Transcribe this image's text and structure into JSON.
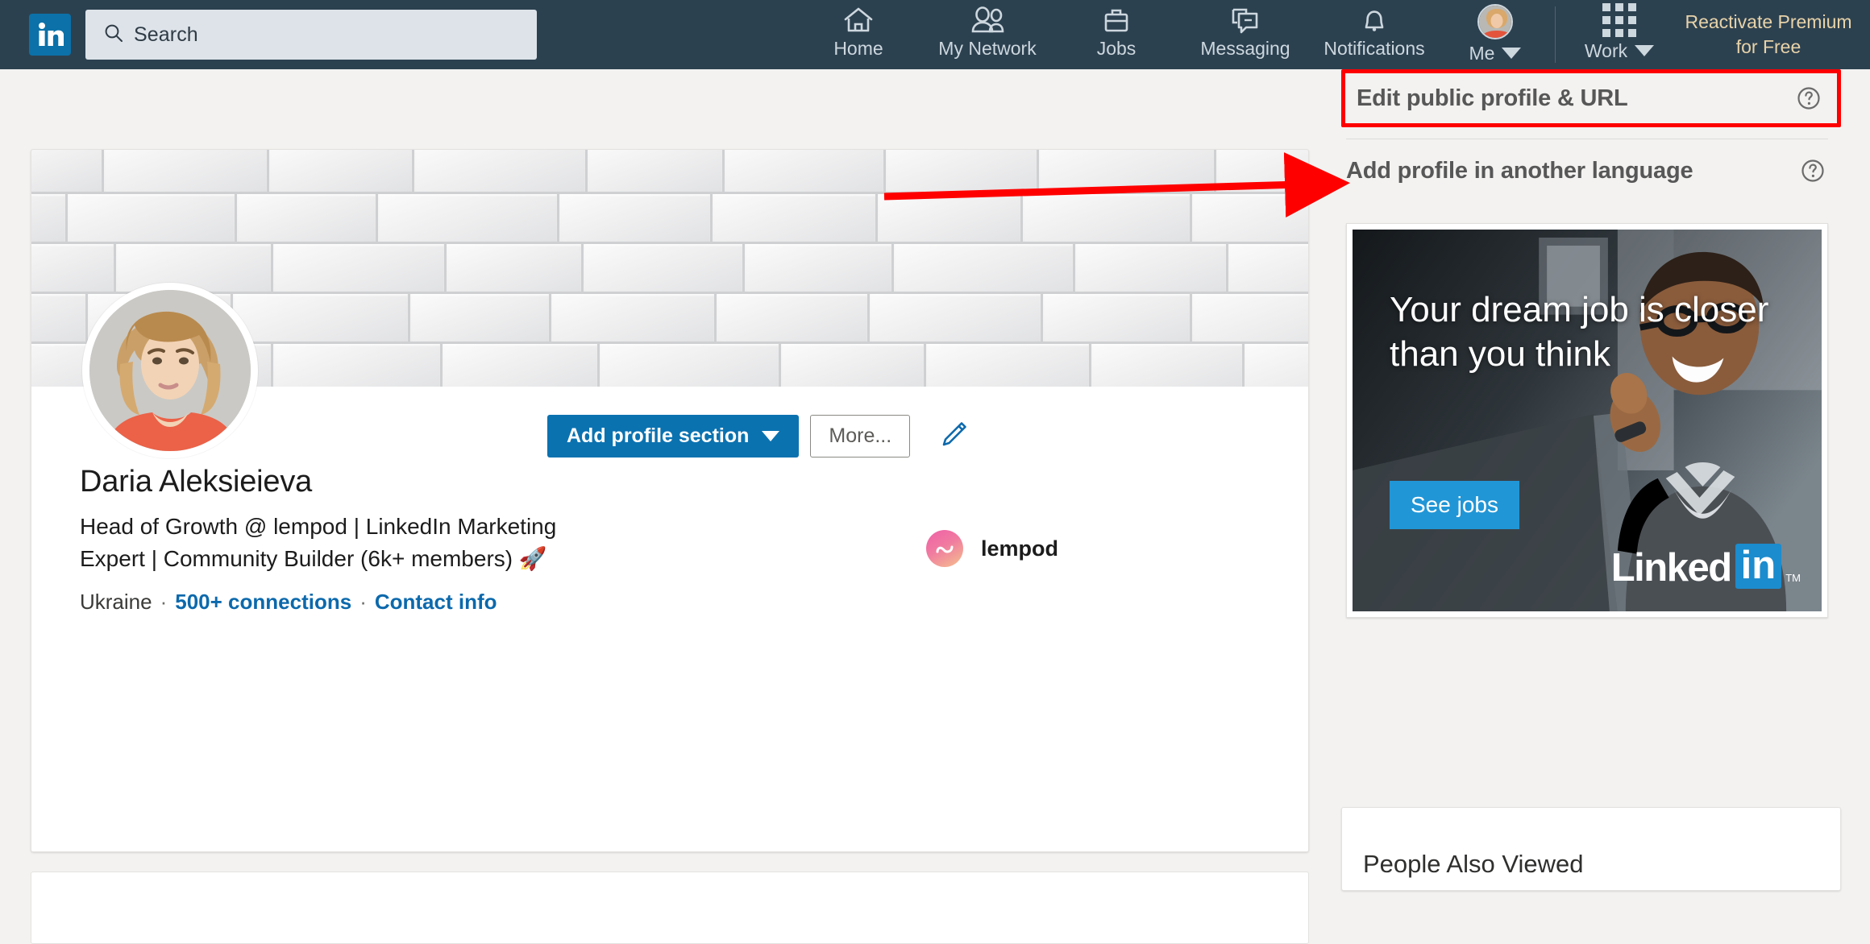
{
  "nav": {
    "logo_alt": "LinkedIn",
    "search_placeholder": "Search",
    "items": [
      {
        "label": "Home",
        "icon": "home-icon"
      },
      {
        "label": "My Network",
        "icon": "people-icon"
      },
      {
        "label": "Jobs",
        "icon": "briefcase-icon"
      },
      {
        "label": "Messaging",
        "icon": "message-icon"
      },
      {
        "label": "Notifications",
        "icon": "bell-icon"
      }
    ],
    "me_label": "Me",
    "work_label": "Work",
    "premium_label": "Reactivate Premium for Free"
  },
  "profile": {
    "name": "Daria Aleksieieva",
    "headline": "Head of Growth @ lempod | LinkedIn Marketing Expert | Community Builder (6k+ members) 🚀",
    "location": "Ukraine",
    "separator": "·",
    "connections": "500+ connections",
    "contact_info": "Contact info",
    "company_name": "lempod",
    "buttons": {
      "add_section": "Add profile section",
      "more": "More..."
    },
    "edit_icon": "pencil-icon"
  },
  "sidebar": {
    "links": [
      {
        "label": "Edit public profile & URL",
        "help_icon": "question-circle-icon",
        "highlighted": true
      },
      {
        "label": "Add profile in another language",
        "help_icon": "question-circle-icon",
        "highlighted": false
      }
    ],
    "ad": {
      "headline": "Your dream job is closer than you think",
      "cta": "See jobs",
      "brand_word": "Linked",
      "brand_box": "in",
      "trademark": "TM"
    },
    "people_also_viewed": "People Also Viewed"
  },
  "colors": {
    "nav_background": "#2c4150",
    "brand_blue": "#0b72b0",
    "link_blue": "#0c69ac",
    "premium_gold": "#e8d3a9",
    "annotation_red": "#ff0000",
    "page_background": "#f3f2f0"
  }
}
